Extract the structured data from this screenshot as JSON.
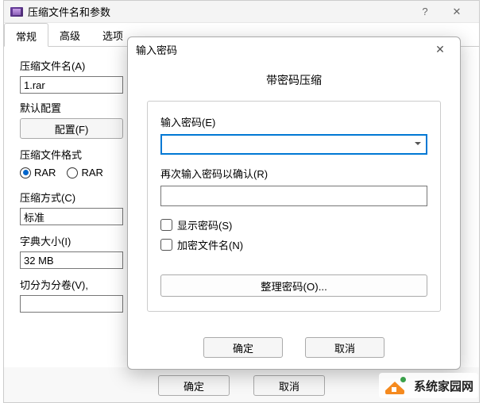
{
  "main": {
    "title": "压缩文件名和参数",
    "help_glyph": "?",
    "close_glyph": "✕",
    "tabs": [
      "常规",
      "高级",
      "选项"
    ],
    "filename_label": "压缩文件名(A)",
    "filename_value": "1.rar",
    "default_profile_label": "默认配置",
    "profile_btn": "配置(F)",
    "format_label": "压缩文件格式",
    "format_opts": {
      "rar": "RAR",
      "rar4": "RAR"
    },
    "method_label": "压缩方式(C)",
    "method_value": "标准",
    "dict_label": "字典大小(I)",
    "dict_value": "32 MB",
    "split_label": "切分为分卷(V), ",
    "ok": "确定",
    "cancel": "取消"
  },
  "pw": {
    "dialog_title": "输入密码",
    "header": "带密码压缩",
    "enter_label": "输入密码(E)",
    "enter_value": "",
    "confirm_label": "再次输入密码以确认(R)",
    "confirm_value": "",
    "show_pw": "显示密码(S)",
    "encrypt_names": "加密文件名(N)",
    "organize": "整理密码(O)...",
    "ok": "确定",
    "cancel": "取消"
  },
  "watermark": {
    "text": "系统家园网"
  }
}
